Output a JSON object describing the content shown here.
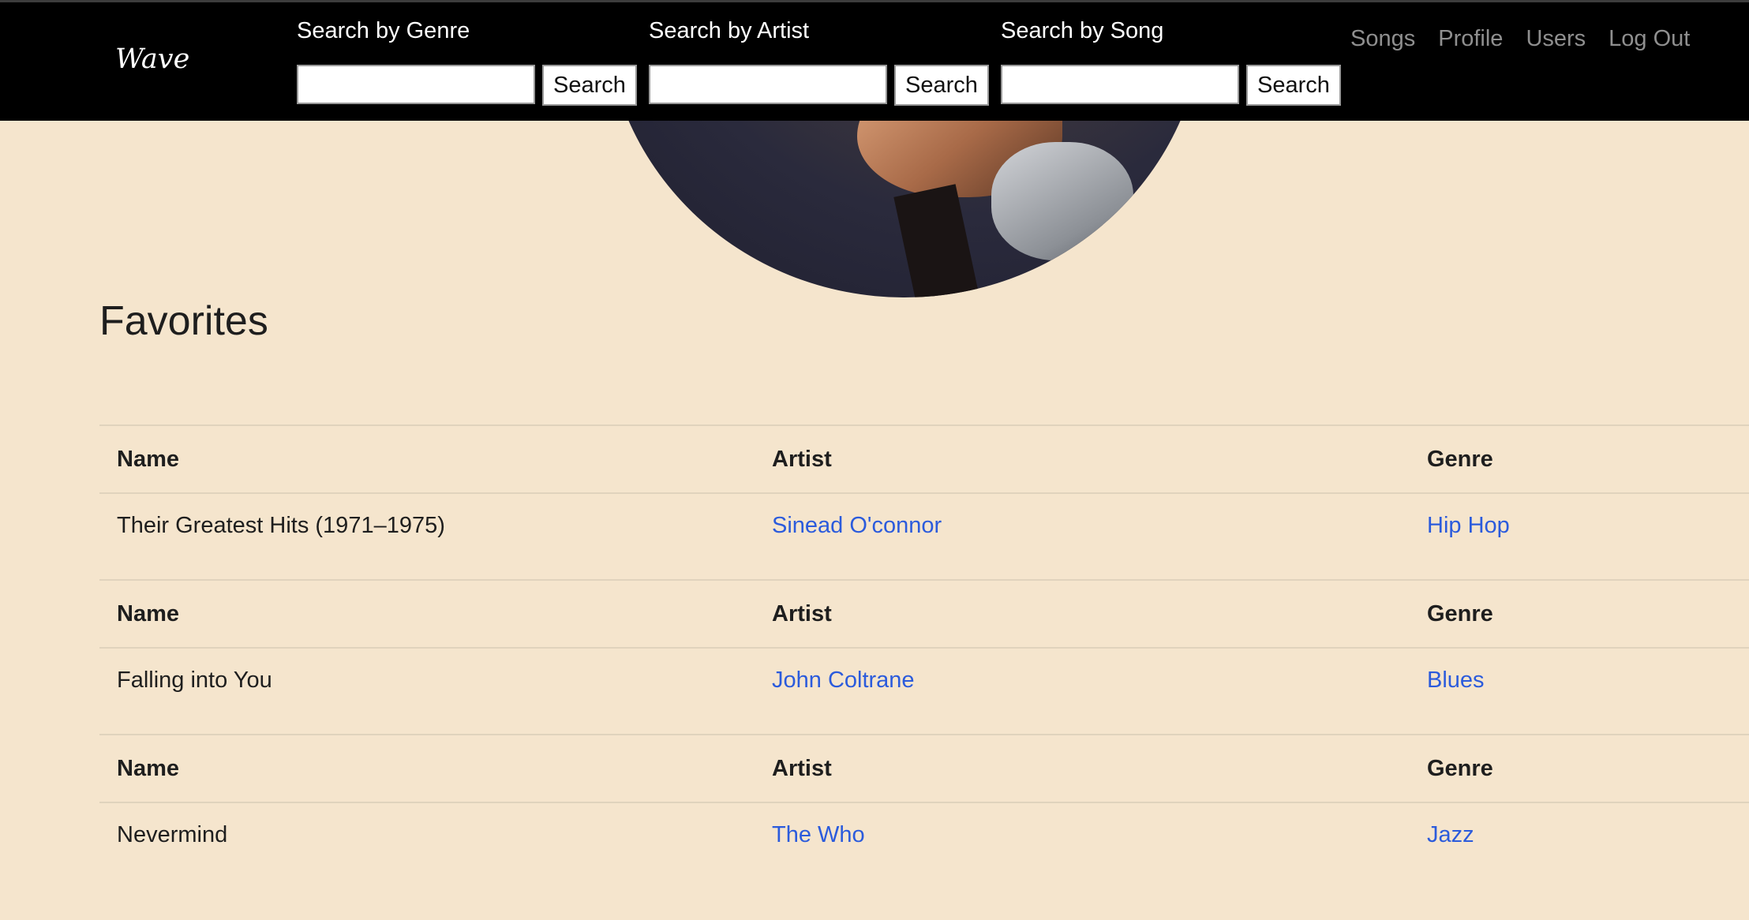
{
  "brand": "Wave",
  "search": [
    {
      "label": "Search by Genre",
      "value": "",
      "button": "Search"
    },
    {
      "label": "Search by Artist",
      "value": "",
      "button": "Search"
    },
    {
      "label": "Search by Song",
      "value": "",
      "button": "Search"
    }
  ],
  "nav": [
    "Songs",
    "Profile",
    "Users",
    "Log Out"
  ],
  "favorites": {
    "title": "Favorites",
    "headers": {
      "name": "Name",
      "artist": "Artist",
      "genre": "Genre"
    },
    "rows": [
      {
        "name": "Their Greatest Hits (1971–1975)",
        "artist": "Sinead O'connor",
        "genre": "Hip Hop"
      },
      {
        "name": "Falling into You",
        "artist": "John Coltrane",
        "genre": "Blues"
      },
      {
        "name": "Nevermind",
        "artist": "The Who",
        "genre": "Jazz"
      }
    ]
  },
  "colors": {
    "background": "#f5e5cd",
    "header": "#000000",
    "link": "#2b5bdc",
    "nav": "#8f8f8f"
  }
}
